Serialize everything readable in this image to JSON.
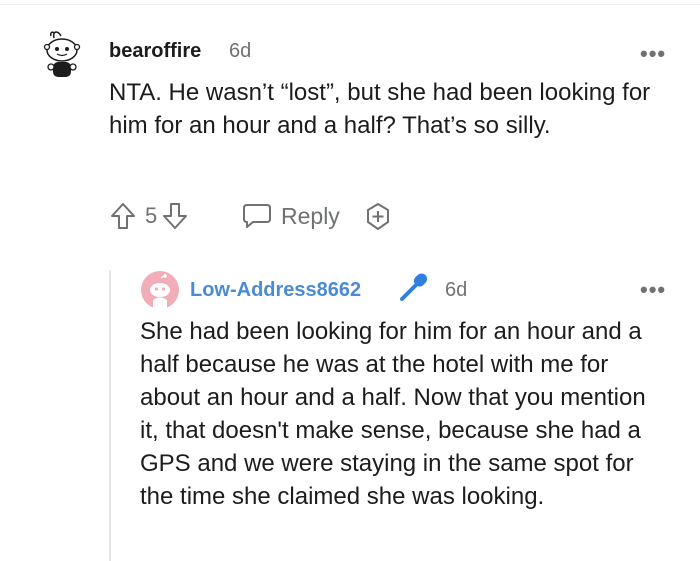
{
  "comment": {
    "username": "bearoffire",
    "age": "6d",
    "body": "NTA. He wasn’t “lost”, but she had been looking for him for an hour and a half? That’s so silly.",
    "votes": "5",
    "reply_label": "Reply",
    "more_label": "•••"
  },
  "reply": {
    "username": "Low-Address8662",
    "age": "6d",
    "body": "She had been looking for him for an hour and a half because he was at the hotel with me for about an hour and a half. Now that you mention it, that doesn't make sense, because she had a GPS and we were staying in the same spot for the time she claimed she was looking.",
    "more_label": "•••"
  },
  "colors": {
    "username_reply": "#4a8bd6",
    "mic": "#2f7fe0",
    "muted": "#6f7173",
    "avatar_pink": "#f2aeb8"
  },
  "icons": [
    "snoo-avatar-icon",
    "upvote-icon",
    "downvote-icon",
    "comment-bubble-icon",
    "award-add-icon",
    "snoo-avatar-pink-icon",
    "microphone-icon",
    "more-options-icon"
  ]
}
